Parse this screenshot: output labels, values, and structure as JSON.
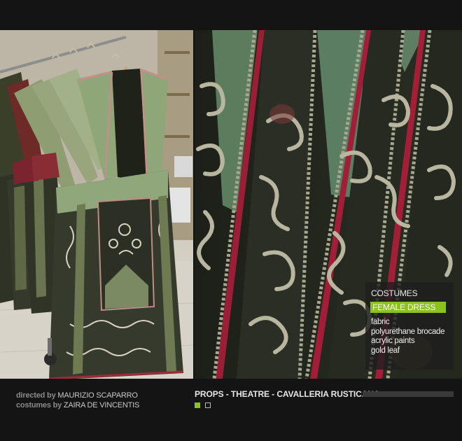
{
  "caption": {
    "section": "COSTUMES",
    "badge": "FEMALE DRESS",
    "materials": [
      "fabric",
      "polyurethane brocade",
      "acrylic paints",
      "gold leaf"
    ]
  },
  "footer": {
    "directed_label": "directed by",
    "director": "MAURIZIO SCAPARRO",
    "costumes_label": "costumes by",
    "costume_designer": "ZAIRA DE VINCENTIS",
    "project_title": "PROPS - THEATRE - CAVALLERIA RUSTICANA",
    "pages": 2,
    "current_page": 1
  },
  "colors": {
    "accent": "#8cc21c",
    "background": "#141414"
  }
}
